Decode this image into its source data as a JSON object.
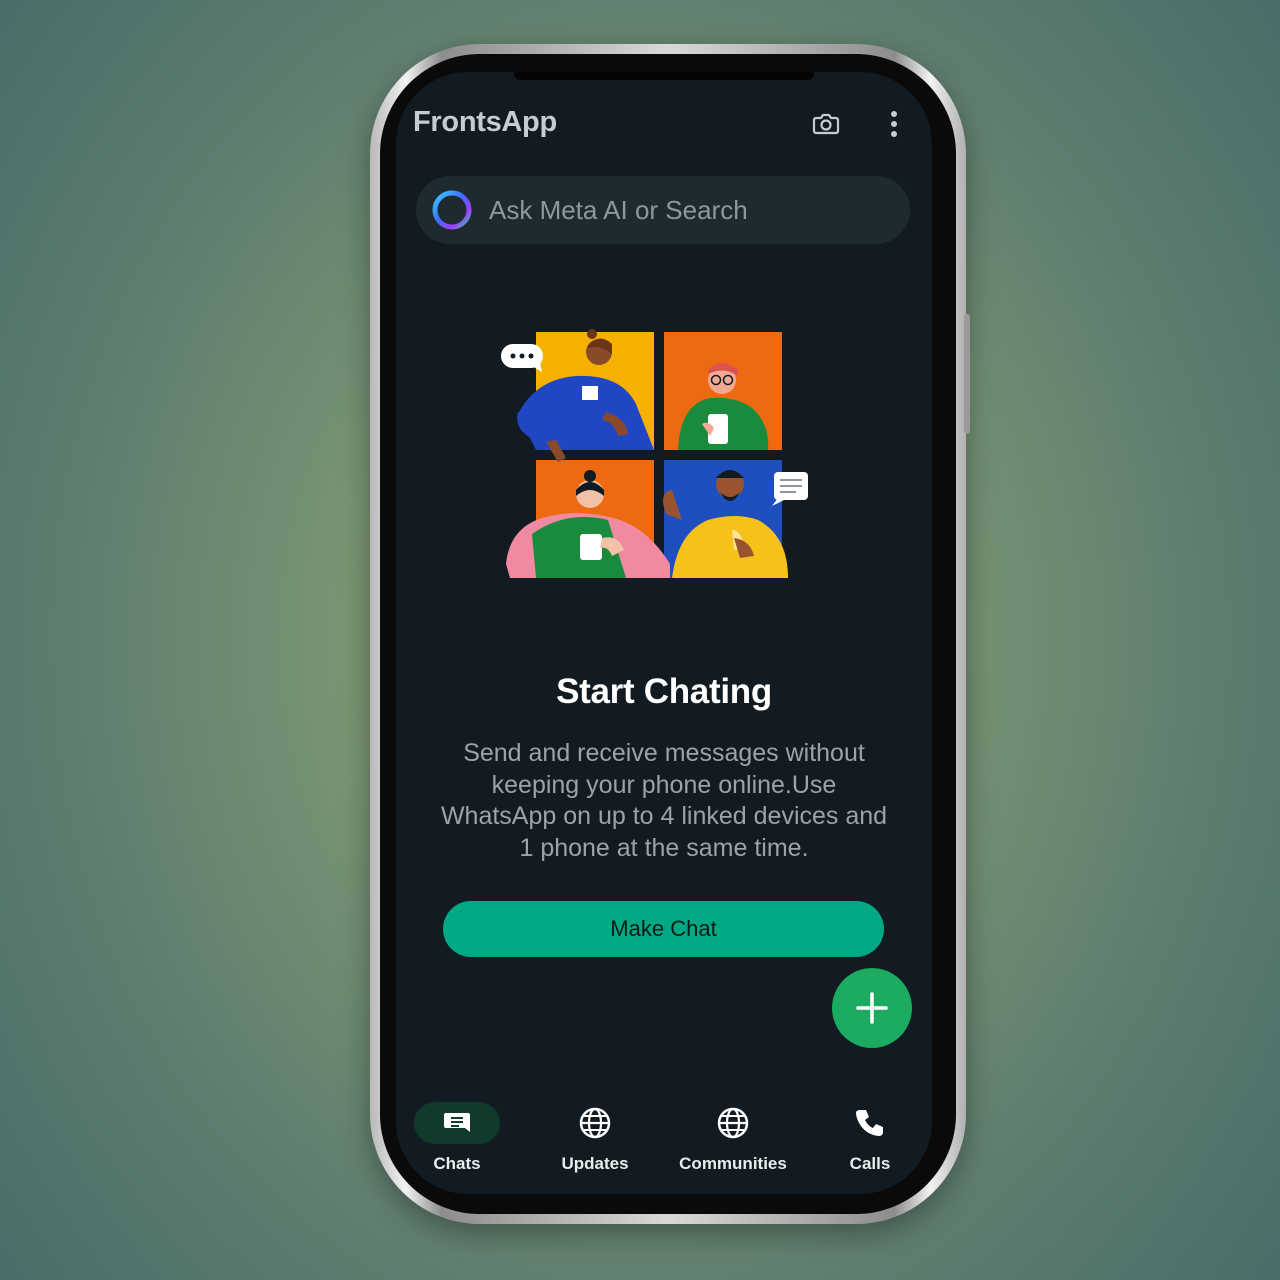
{
  "app": {
    "title": "FrontsApp"
  },
  "header": {
    "camera_icon": "camera-icon",
    "menu_icon": "more-vertical-icon"
  },
  "search": {
    "placeholder": "Ask Meta AI or Search",
    "icon": "meta-ai-ring-icon"
  },
  "empty_state": {
    "title": "Start Chating",
    "description": "Send and receive messages without keeping your phone online.Use WhatsApp on up to 4 linked devices and 1 phone at the same time.",
    "button_label": "Make Chat"
  },
  "fab": {
    "icon": "plus-icon"
  },
  "bottom_nav": {
    "items": [
      {
        "label": "Chats",
        "icon": "chat-icon",
        "active": true
      },
      {
        "label": "Updates",
        "icon": "globe-icon",
        "active": false
      },
      {
        "label": "Communities",
        "icon": "globe-icon",
        "active": false
      },
      {
        "label": "Calls",
        "icon": "phone-icon",
        "active": false
      }
    ]
  },
  "colors": {
    "accent": "#00a884",
    "fab": "#1daa61",
    "background": "#111b21",
    "active_nav_pill": "#103a29"
  }
}
